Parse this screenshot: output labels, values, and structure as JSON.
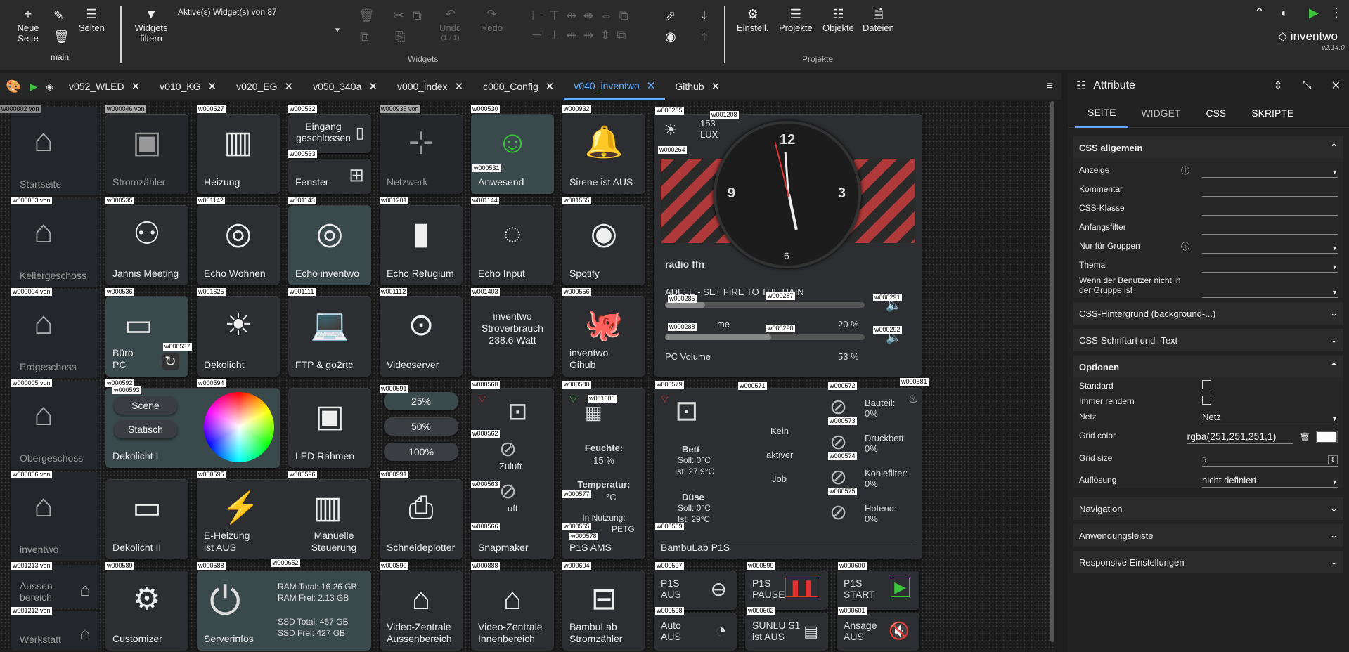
{
  "toolbar": {
    "new_page": "Neue Seite",
    "pages": "Seiten",
    "main": "main",
    "filter": "Widgets filtern",
    "active_widgets": "Aktive(s) Widget(s) von 87",
    "undo": "Undo",
    "undo_count": "(1 / 1)",
    "redo": "Redo",
    "widgets_group": "Widgets",
    "settings": "Einstell.",
    "projects": "Projekte",
    "objects": "Objekte",
    "files": "Dateien",
    "projects_group": "Projekte",
    "brand": "inventwo",
    "version": "v2.14.0"
  },
  "tabs": [
    "v052_WLED",
    "v010_KG",
    "v020_EG",
    "v050_340a",
    "v000_index",
    "c000_Config",
    "v040_inventwo",
    "Github"
  ],
  "sidebar": [
    "Startseite",
    "Kellergeschoss",
    "Erdgeschoss",
    "Obergeschoss",
    "inventwo",
    "Aussen-\nbereich",
    "Werkstatt"
  ],
  "sidebar_tags": [
    "w000002 von",
    "w000003 von",
    "w000004 von",
    "w000005 von",
    "w000006 von",
    "w001213 von",
    "w001212 von"
  ],
  "widgets": {
    "strom": "Stromzähler",
    "heizung": "Heizung",
    "eingang": "Eingang geschlossen",
    "fenster": "Fenster",
    "netzwerk": "Netzwerk",
    "anwesend": "Anwesend",
    "sirene": "Sirene ist AUS",
    "jannis": "Jannis Meeting",
    "echo_wohnen": "Echo Wohnen",
    "echo_inventwo": "Echo inventwo",
    "echo_refugium": "Echo Refugium",
    "echo_input": "Echo Input",
    "spotify": "Spotify",
    "buero": "Büro PC",
    "dekolicht": "Dekolicht",
    "ftp": "FTP & go2rtc",
    "videoserver": "Videoserver",
    "stromverbrauch": "inventwo Stroverbrauch 238.6 Watt",
    "github": "inventwo Gihub",
    "scene": "Scene",
    "statisch": "Statisch",
    "dekolicht1": "Dekolicht I",
    "led": "LED Rahmen",
    "p25": "25%",
    "p50": "50%",
    "p100": "100%",
    "zuluft": "Zuluft",
    "abluft": "uft",
    "snapmaker": "Snapmaker",
    "feuchte_l": "Feuchte:",
    "feuchte_v": "15 %",
    "temp_l": "Temperatur:",
    "temp_v": "°C",
    "nutzung": "In Nutzung:",
    "petg": "PETG",
    "p1s_ams": "P1S AMS",
    "bett": "Bett",
    "bett_soll": "Soll: 0°C",
    "bett_ist": "Ist: 27.9°C",
    "duese": "Düse",
    "duese_soll": "Soll: 0°C",
    "duese_ist": "Ist: 29°C",
    "kein": "Kein",
    "aktiver": "aktiver",
    "job": "Job",
    "bambu": "BambuLab P1S",
    "bauteil": "Bauteil: 0%",
    "druckbett": "Druckbett: 0%",
    "kohlefilter": "Kohlefilter: 0%",
    "hotend": "Hotend: 0%",
    "dekolicht2": "Dekolicht II",
    "eheizung": "E-Heizung ist AUS",
    "manuelle": "Manuelle Steuerung",
    "schneideplotter": "Schneideplotter",
    "customizer": "Customizer",
    "serverinfos": "Serverinfos",
    "ram_total": "RAM Total: 16.26 GB",
    "ram_frei": "RAM Frei: 2.13 GB",
    "ssd_total": "SSD Total: 467 GB",
    "ssd_frei": "SSD Frei: 427 GB",
    "vz_aussen": "Video-Zentrale Aussenbereich",
    "vz_innen": "Video-Zentrale Innenbereich",
    "bambu_strom": "BambuLab Stromzähler",
    "p1s_aus": "P1S AUS",
    "p1s_pause": "P1S PAUSE",
    "p1s_start": "P1S START",
    "auto_aus": "Auto AUS",
    "sunlu": "SUNLU S1 ist AUS",
    "ansage": "Ansage AUS",
    "lux_v": "153",
    "lux_u": "LUX",
    "radio": "radio ffn",
    "song": "ADELE - SET FIRE TO THE RAIN",
    "vol1_l": "me",
    "vol1_v": "20 %",
    "vol2_l": "PC Volume",
    "vol2_v": "53 %",
    "clock12": "12",
    "clock9": "9",
    "clock3": "3",
    "clock6": "6"
  },
  "tags": [
    "w000046 von",
    "w000527",
    "w000532",
    "w000533",
    "w000935 von",
    "w000530",
    "w000531",
    "w000932",
    "w000265",
    "w001208",
    "w000264",
    "w000535",
    "w001142",
    "w001143",
    "w001201",
    "w001144",
    "w001565",
    "w000536",
    "w000537",
    "w001625",
    "w001111",
    "w001112",
    "w001403",
    "w000556",
    "w000285",
    "w000287",
    "w000291",
    "w000288",
    "w000290",
    "w000292",
    "w000592",
    "w000593",
    "w000594",
    "w000591",
    "w000560",
    "w000580",
    "w001606",
    "w000579",
    "w000571",
    "w000572",
    "w000581",
    "w000562",
    "w000573",
    "w000574",
    "w000563",
    "w000577",
    "w000575",
    "w000565",
    "w000566",
    "w000578",
    "w000569",
    "w000595",
    "w000596",
    "w000991",
    "w000589",
    "w000588",
    "w000652",
    "w000890",
    "w000888",
    "w000604",
    "w000597",
    "w000599",
    "w000600",
    "w000598",
    "w000602",
    "w000601"
  ],
  "panel": {
    "title": "Attribute",
    "tabs": [
      "SEITE",
      "WIDGET",
      "CSS",
      "SKRIPTE"
    ],
    "css_allg": "CSS allgemein",
    "anzeige": "Anzeige",
    "kommentar": "Kommentar",
    "css_klasse": "CSS-Klasse",
    "anfangsfilter": "Anfangsfilter",
    "nur_gruppen": "Nur für Gruppen",
    "thema": "Thema",
    "wenn": "Wenn der Benutzer nicht in der Gruppe ist",
    "css_bg": "CSS-Hintergrund (background-...)",
    "css_font": "CSS-Schriftart und -Text",
    "optionen": "Optionen",
    "standard": "Standard",
    "immer": "Immer rendern",
    "netz_k": "Netz",
    "netz_v": "Netz",
    "grid_color_k": "Grid color",
    "grid_color_v": "rgba(251,251,251,1)",
    "grid_size_k": "Grid size",
    "grid_size_v": "5",
    "aufl_k": "Auflösung",
    "aufl_v": "nicht definiert",
    "navigation": "Navigation",
    "anwendungsleiste": "Anwendungsleiste",
    "responsive": "Responsive Einstellungen"
  },
  "colors": {
    "accent": "#64aaff",
    "bg": "#1b1b1b",
    "tile": "#2c2e31",
    "red_stripe": "#b03a3a",
    "green": "#3cc43c"
  }
}
